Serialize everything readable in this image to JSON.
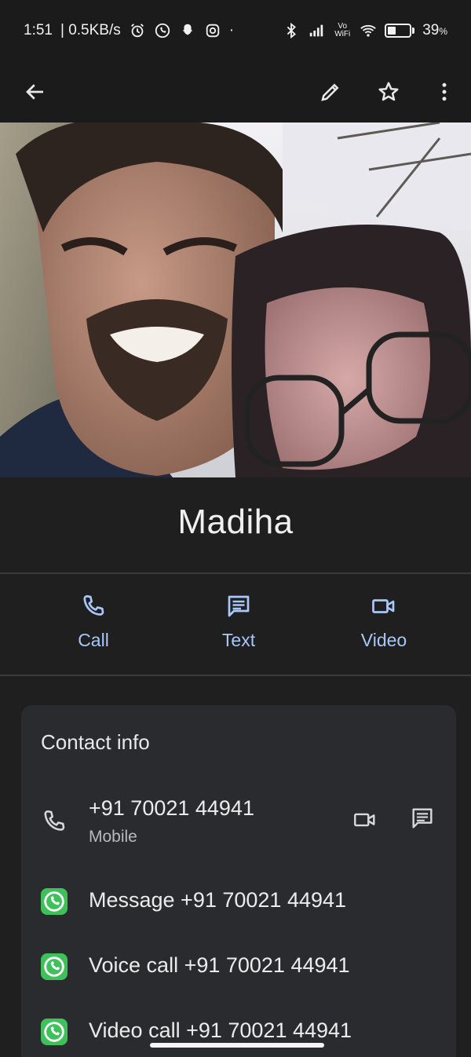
{
  "status_bar": {
    "time": "1:51",
    "speed": "| 0.5KB/s",
    "icons_left": [
      "alarm-icon",
      "whatsapp-status-icon",
      "snapchat-icon",
      "instagram-icon"
    ],
    "dot": "·",
    "icons_right": [
      "bluetooth-icon",
      "signal-icon",
      "vowifi-icon",
      "wifi-icon"
    ],
    "vowifi": "Vo WiFi",
    "battery_percent": "39",
    "battery_unit": "%",
    "battery_level": 0.39
  },
  "app_bar": {
    "icons": [
      "back-arrow-icon",
      "edit-pencil-icon",
      "star-icon",
      "more-vert-icon"
    ]
  },
  "contact": {
    "name": "Madiha"
  },
  "actions": [
    {
      "label": "Call",
      "icon": "phone-icon"
    },
    {
      "label": "Text",
      "icon": "message-icon"
    },
    {
      "label": "Video",
      "icon": "videocam-icon"
    }
  ],
  "contact_info": {
    "title": "Contact info",
    "phone": {
      "number": "+91 70021 44941",
      "type": "Mobile"
    },
    "whatsapp_rows": [
      {
        "text": "Message +91 70021 44941"
      },
      {
        "text": "Voice call +91 70021 44941"
      },
      {
        "text": "Video call +91 70021 44941"
      }
    ]
  },
  "colors": {
    "background": "#1f1f1f",
    "card": "#2a2b2e",
    "accent": "#a8c7fa",
    "whatsapp": "#3ec15a"
  }
}
